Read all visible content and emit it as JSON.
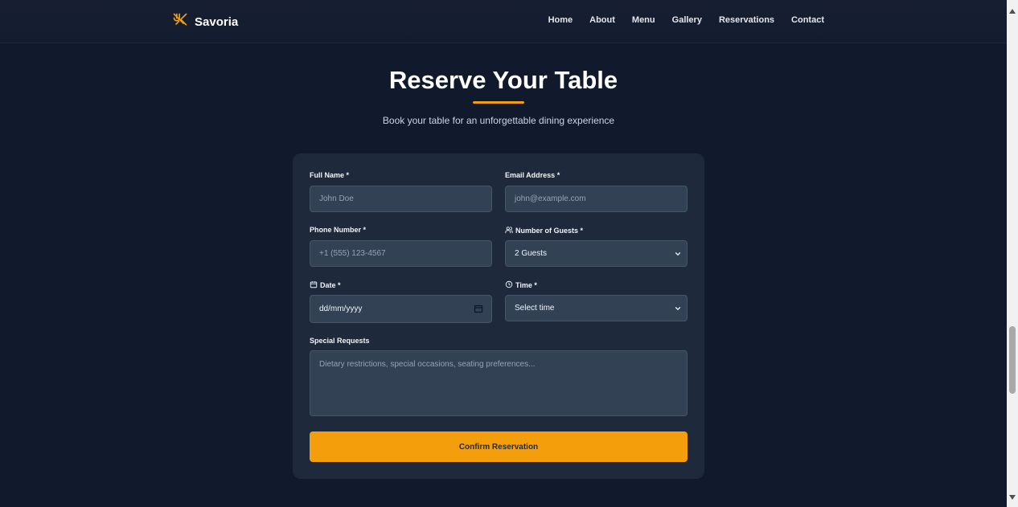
{
  "brand": {
    "name": "Savoria",
    "accent": "#f59e0b"
  },
  "nav": {
    "items": [
      "Home",
      "About",
      "Menu",
      "Gallery",
      "Reservations",
      "Contact"
    ]
  },
  "hero": {
    "title": "Reserve Your Table",
    "subtitle": "Book your table for an unforgettable dining experience"
  },
  "form": {
    "full_name": {
      "label": "Full Name *",
      "placeholder": "John Doe"
    },
    "email": {
      "label": "Email Address *",
      "placeholder": "john@example.com"
    },
    "phone": {
      "label": "Phone Number *",
      "placeholder": "+1 (555) 123-4567"
    },
    "guests": {
      "label": "Number of Guests *",
      "value": "2 Guests"
    },
    "date": {
      "label": "Date *",
      "placeholder": "dd/mm/yyyy"
    },
    "time": {
      "label": "Time *",
      "value": "Select time"
    },
    "special_requests": {
      "label": "Special Requests",
      "placeholder": "Dietary restrictions, special occasions, seating preferences..."
    },
    "submit_label": "Confirm Reservation"
  },
  "icons": {
    "brand": "utensils-icon",
    "guests": "users-icon",
    "date": "calendar-icon",
    "time": "clock-icon",
    "select": "chevron-down-icon"
  }
}
